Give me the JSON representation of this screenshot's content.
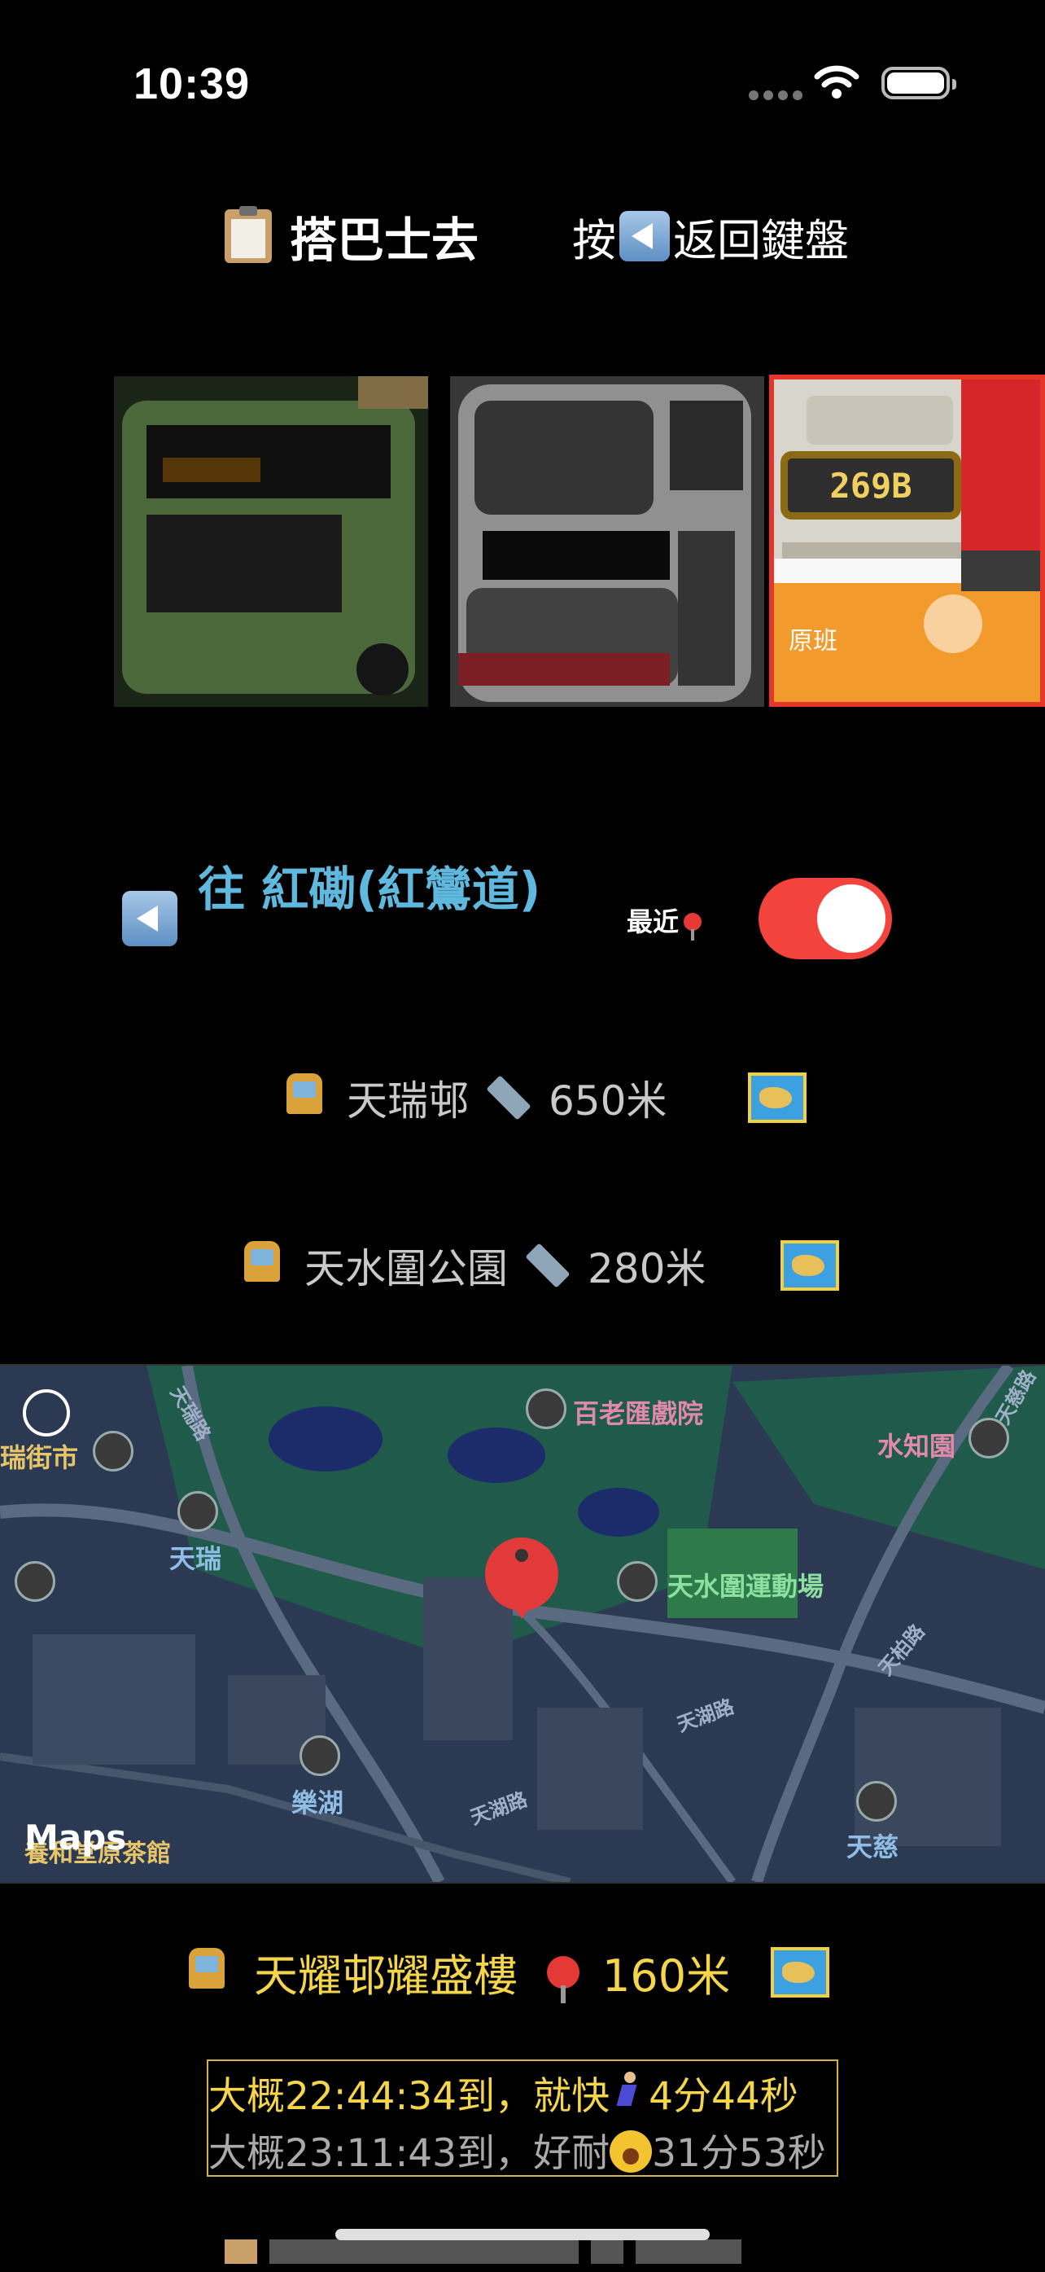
{
  "status_bar": {
    "time": "10:39"
  },
  "header": {
    "title": "搭巴士去",
    "back_hint_prefix": "按",
    "back_hint_suffix": "返回鍵盤"
  },
  "bus_images": {
    "route_number": "269B",
    "original_label": "原班"
  },
  "direction": {
    "destination": "往 紅磡(紅鸞道)",
    "nearest_label": "最近",
    "nearest_toggle_on": true
  },
  "stops": [
    {
      "name": "天瑞邨",
      "distance": "650米"
    },
    {
      "name": "天水圍公園",
      "distance": "280米"
    }
  ],
  "map": {
    "labels": {
      "theatre": "百老匯戲院",
      "park": "水知園",
      "market": "瑞街市",
      "station_tin_shui": "天瑞",
      "sports_ground": "天水圍運動場",
      "station_lok_wu": "樂湖",
      "station_tin_tsz": "天慈",
      "library": "養和堂原茶館",
      "road_1": "天瑞路",
      "road_2": "天湖路",
      "road_3": "天湖路",
      "road_4": "天柏路",
      "road_5": "天慈路"
    },
    "logo": "Maps"
  },
  "selected_stop": {
    "name": "天耀邨耀盛樓",
    "distance": "160米"
  },
  "arrivals": [
    {
      "time_text": "大概22:44:34到，就快",
      "eta": "4分44秒"
    },
    {
      "time_text": "大概23:11:43到，好耐",
      "eta": "31分53秒"
    }
  ],
  "colors": {
    "destination": "#5fb8dd",
    "toggle_on": "#f2433d",
    "selected_stop": "#f5d64a",
    "selected_border": "#e5362c"
  }
}
